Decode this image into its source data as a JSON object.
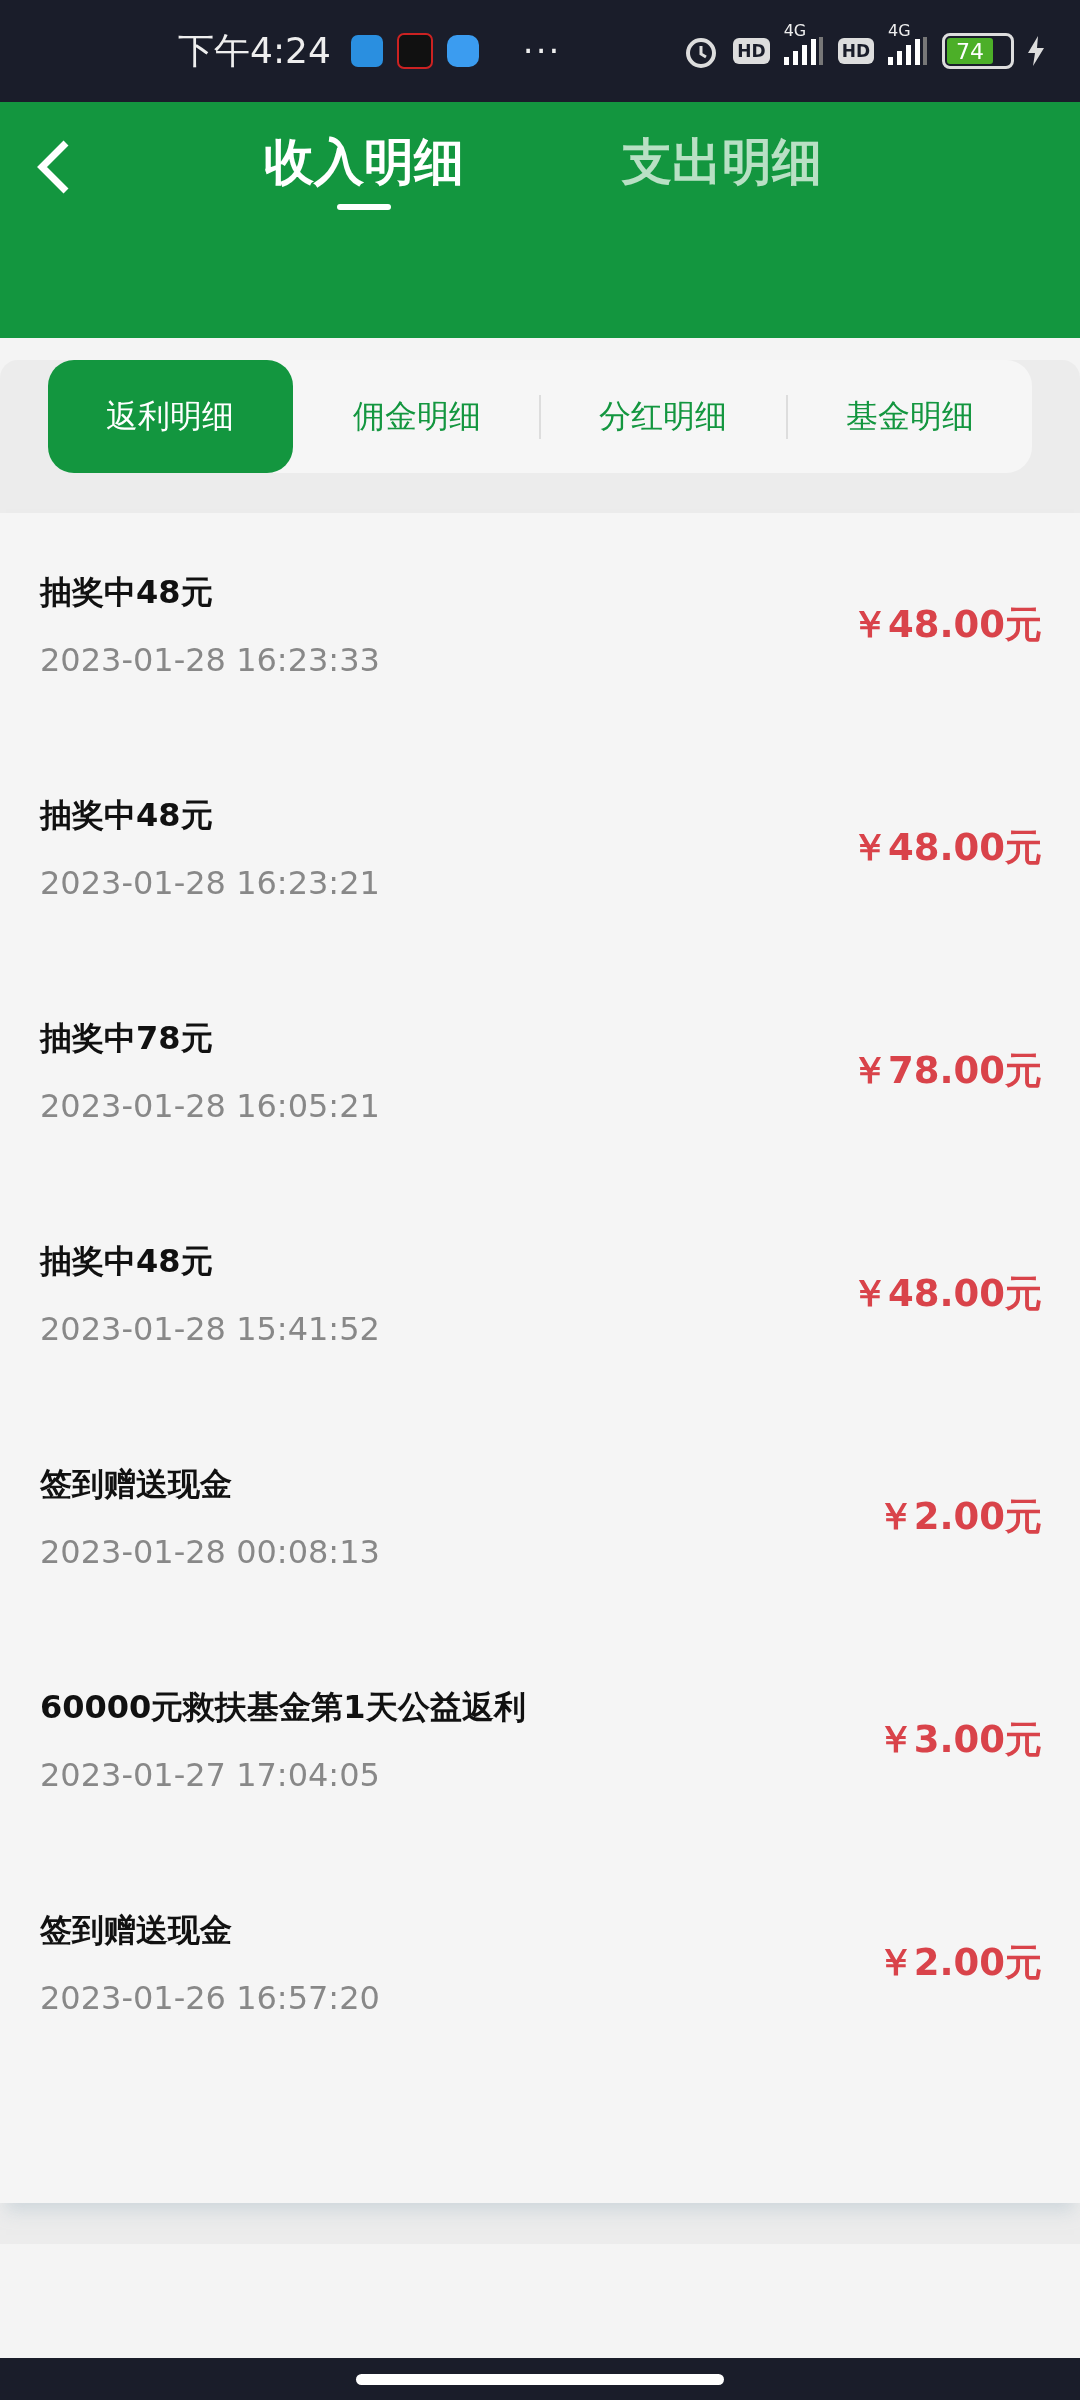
{
  "status_bar": {
    "time": "下午4:24",
    "more": "···",
    "sims": [
      {
        "hd": "HD",
        "network": "4G"
      },
      {
        "hd": "HD",
        "network": "4G"
      }
    ],
    "battery": "74"
  },
  "header": {
    "tabs": [
      {
        "label": "收入明细",
        "selected": true
      },
      {
        "label": "支出明细",
        "selected": false
      }
    ]
  },
  "sub_tabs": [
    {
      "label": "返利明细",
      "selected": true
    },
    {
      "label": "佣金明细",
      "selected": false
    },
    {
      "label": "分红明细",
      "selected": false
    },
    {
      "label": "基金明细",
      "selected": false
    }
  ],
  "records": [
    {
      "title": "抽奖中48元",
      "time": "2023-01-28 16:23:33",
      "amount": "￥48.00元"
    },
    {
      "title": "抽奖中48元",
      "time": "2023-01-28 16:23:21",
      "amount": "￥48.00元"
    },
    {
      "title": "抽奖中78元",
      "time": "2023-01-28 16:05:21",
      "amount": "￥78.00元"
    },
    {
      "title": "抽奖中48元",
      "time": "2023-01-28 15:41:52",
      "amount": "￥48.00元"
    },
    {
      "title": "签到赠送现金",
      "time": "2023-01-28 00:08:13",
      "amount": "￥2.00元"
    },
    {
      "title": "60000元救扶基金第1天公益返利",
      "time": "2023-01-27 17:04:05",
      "amount": "￥3.00元"
    },
    {
      "title": "签到赠送现金",
      "time": "2023-01-26 16:57:20",
      "amount": "￥2.00元"
    }
  ]
}
